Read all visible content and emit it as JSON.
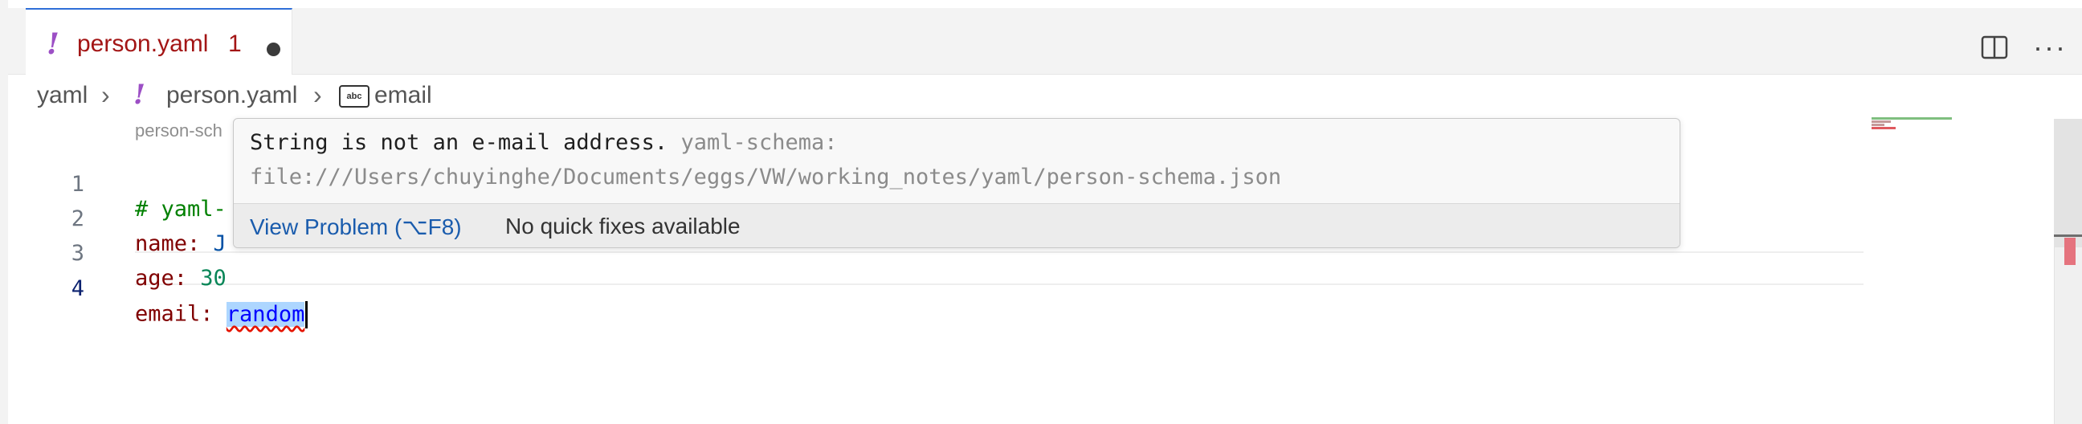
{
  "tab": {
    "icon": "yaml-exclamation-icon",
    "bang": "!",
    "filename": "person.yaml",
    "problem_count": "1"
  },
  "toolbar": {
    "split_icon": "split-editor-icon",
    "more_label": "···"
  },
  "breadcrumb": {
    "folder": "yaml",
    "bang": "!",
    "file": "person.yaml",
    "symbol_icon_text": "abc",
    "symbol": "email"
  },
  "editor": {
    "codelens": "person-sch",
    "lines": [
      {
        "num": "1",
        "parts": [
          {
            "t": "# yaml-",
            "c": "c-comment"
          }
        ]
      },
      {
        "num": "2",
        "parts": [
          {
            "t": "name: ",
            "c": "c-key"
          },
          {
            "t": "J",
            "c": "c-str"
          }
        ]
      },
      {
        "num": "3",
        "parts": [
          {
            "t": "age: ",
            "c": "c-key"
          },
          {
            "t": "30",
            "c": "c-num"
          }
        ]
      },
      {
        "num": "4",
        "parts": [
          {
            "t": "email: ",
            "c": "c-key"
          },
          {
            "t": "random",
            "c": "sel"
          }
        ]
      }
    ],
    "active_line": "4"
  },
  "hover": {
    "message": "String is not an e-mail address.",
    "source": "yaml-schema:",
    "path": "file:///Users/chuyinghe/Documents/eggs/VW/working_notes/yaml/person-schema.json",
    "view_problem": "View Problem (⌥F8)",
    "no_fixes": "No quick fixes available"
  },
  "colors": {
    "tab_accent": "#2f6fd8",
    "error_text": "#a31515",
    "yaml_icon": "#9c4fc5",
    "link": "#1a5cad",
    "squiggle": "#e51400",
    "selection": "#add6ff"
  }
}
